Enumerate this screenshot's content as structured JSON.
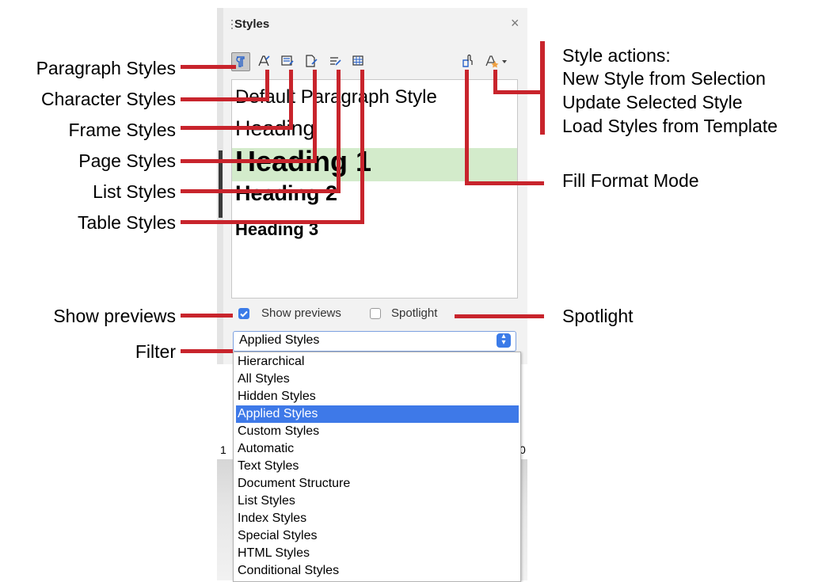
{
  "panel": {
    "title": "Styles",
    "close": "×",
    "style_items": [
      "Default Paragraph Style",
      "Heading",
      "Heading 1",
      "Heading 2",
      "Heading 3"
    ],
    "show_previews_label": "Show previews",
    "show_previews_checked": true,
    "spotlight_label": "Spotlight",
    "spotlight_checked": false,
    "filter_value": "Applied Styles",
    "filter_options": [
      "Hierarchical",
      "All Styles",
      "Hidden Styles",
      "Applied Styles",
      "Custom Styles",
      "Automatic",
      "Text Styles",
      "Document Structure",
      "List Styles",
      "Index Styles",
      "Special Styles",
      "HTML Styles",
      "Conditional Styles"
    ],
    "selected_option": "Applied Styles",
    "toolbar_icons": [
      "paragraph-styles-icon",
      "character-styles-icon",
      "frame-styles-icon",
      "page-styles-icon",
      "list-styles-icon",
      "table-styles-icon",
      "fill-format-mode-icon",
      "style-actions-icon"
    ],
    "ruler_left": "1",
    "ruler_right": "0"
  },
  "callouts": {
    "left": [
      "Paragraph Styles",
      "Character Styles",
      "Frame Styles",
      "Page Styles",
      "List Styles",
      "Table Styles",
      "Show previews",
      "Filter"
    ],
    "style_actions": [
      "Style actions:",
      "New Style from Selection",
      "Update Selected Style",
      "Load Styles from Template"
    ],
    "fill_format": "Fill Format Mode",
    "spotlight": "Spotlight"
  },
  "colors": {
    "callout_line": "#c8242c",
    "accent": "#3e79e8",
    "highlight_row": "#d3ebcb"
  }
}
